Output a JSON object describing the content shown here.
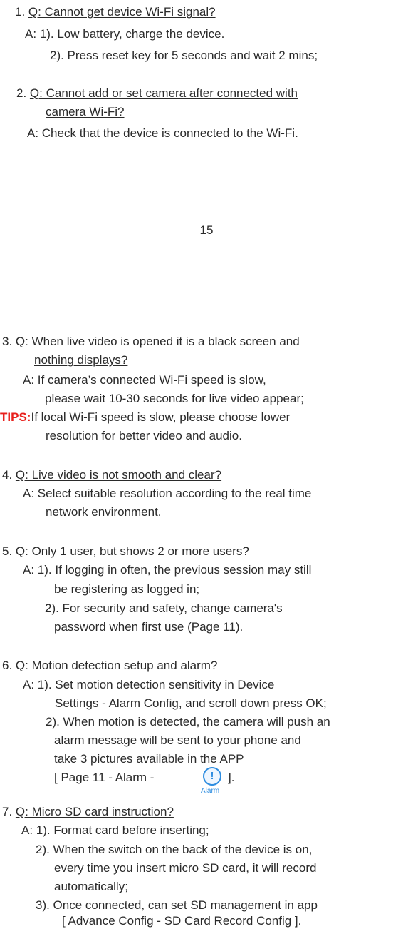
{
  "page1": {
    "q1_num": "1.",
    "q1_q": "Q: Cannot get device Wi-Fi signal?",
    "q1_a1": "A: 1). Low battery, charge the device.",
    "q1_a2": "2). Press reset key for 5 seconds and wait 2 mins;",
    "q2_num": "2.",
    "q2_q1": "Q: Cannot add or set camera after connected with",
    "q2_q2": "camera Wi-Fi?",
    "q2_a": "A: Check that the device is connected to the Wi-Fi.",
    "page_number": "15"
  },
  "page2": {
    "q3_pre": "3. Q: ",
    "q3_q1": "When live video is opened it is a black screen and",
    "q3_q2": "nothing displays?",
    "q3_a1": "A: If camera’s connected Wi-Fi speed is slow,",
    "q3_a2": "please wait 10-30 seconds for live video appear;",
    "tips_label": "TIPS",
    "tips_colon": ":",
    "tips_1": "If local Wi-Fi speed is slow, please choose lower",
    "tips_2": "resolution for better video and audio.",
    "q4_pre": "4. ",
    "q4_q": "Q: Live video is not smooth and clear?",
    "q4_a1": "A: Select suitable resolution according to the real time",
    "q4_a2": "network environment.",
    "q5_pre": "5. ",
    "q5_q": "Q: Only 1 user, but shows 2 or more users?",
    "q5_a1": "A: 1). If logging in often, the previous session may still",
    "q5_a2": "be registering as logged in;",
    "q5_a3": "2). For security and safety, change camera's",
    "q5_a4": "password when first use (Page 11).",
    "q6_pre": "6. ",
    "q6_q": "Q: Motion detection setup and alarm?",
    "q6_a1": "A: 1). Set motion detection sensitivity in Device",
    "q6_a2": "Settings - Alarm Config, and scroll down press OK;",
    "q6_a3": "2). When motion is detected, the camera will push an",
    "q6_a4": "alarm message will be sent to your phone and",
    "q6_a5": "take 3 pictures available in the APP",
    "q6_a6a": "[ Page 11 - Alarm -",
    "q6_a6b": "].",
    "alarm_icon_glyph": "!",
    "alarm_icon_label": "Alarm",
    "q7_pre": "7. ",
    "q7_q": "Q: Micro SD card instruction?",
    "q7_a1": "A: 1). Format card before inserting;",
    "q7_a2": "2). When the switch on the back of the device is on,",
    "q7_a3": "every time you insert micro SD card, it will record",
    "q7_a4": "automatically;",
    "q7_a5": "3). Once connected, can set SD management in app",
    "q7_a6": "[ Advance Config - SD Card Record Config ]."
  },
  "colors": {
    "text": "#2a2a2a",
    "tips": "#e8201c",
    "icon": "#2e8de0"
  }
}
